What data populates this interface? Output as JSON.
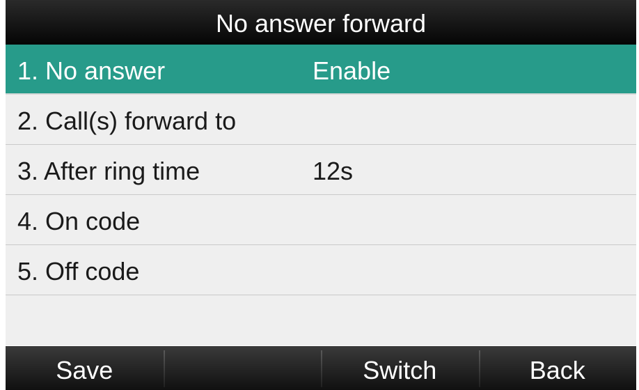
{
  "title": "No answer forward",
  "menu": {
    "items": [
      {
        "label": "1. No answer",
        "value": "Enable"
      },
      {
        "label": "2. Call(s) forward to",
        "value": ""
      },
      {
        "label": "3. After ring time",
        "value": "12s"
      },
      {
        "label": "4. On code",
        "value": ""
      },
      {
        "label": "5. Off code",
        "value": ""
      }
    ],
    "selected_index": 0
  },
  "softkeys": {
    "key1": "Save",
    "key2": "",
    "key3": "Switch",
    "key4": "Back"
  },
  "colors": {
    "selected_row": "#279b8a",
    "title_bar": "#0a0a0a",
    "row_background": "#efefef"
  }
}
